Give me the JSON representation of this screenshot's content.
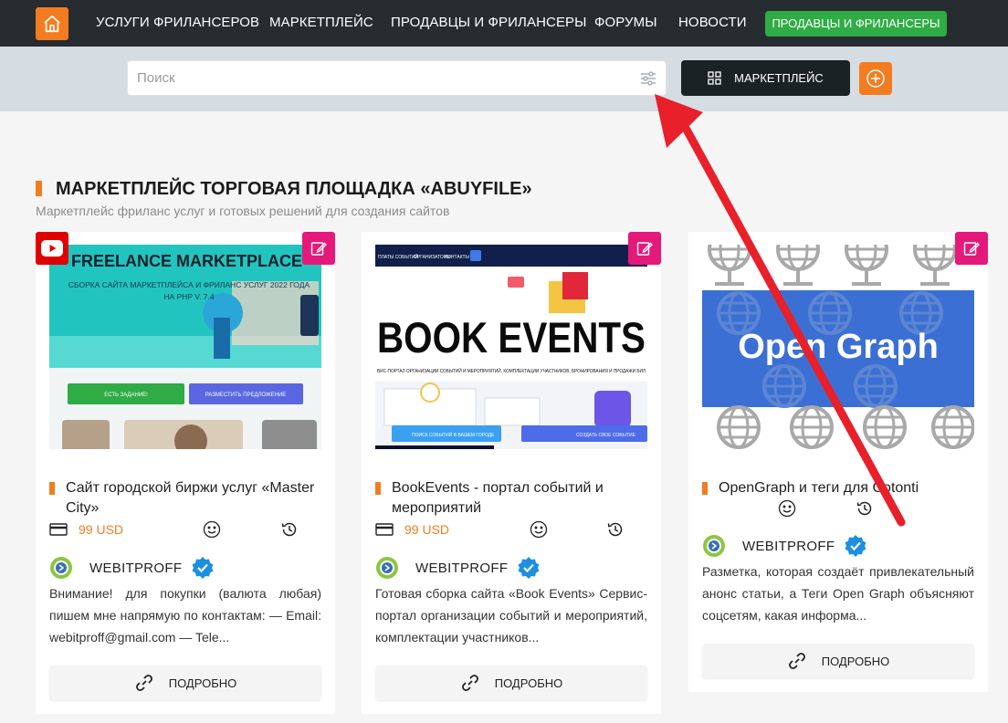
{
  "nav": {
    "items": [
      {
        "label": "УСЛУГИ ФРИЛАНСЕРОВ"
      },
      {
        "label": "МАРКЕТПЛЕЙС"
      },
      {
        "label": "ПРОДАВЦЫ И ФРИЛАНСЕРЫ"
      },
      {
        "label": "ФОРУМЫ"
      },
      {
        "label": "НОВОСТИ"
      }
    ],
    "green_button": "ПРОДАВЦЫ И ФРИЛАНСЕРЫ"
  },
  "search": {
    "placeholder": "Поиск",
    "marketplace_button": "МАРКЕТПЛЕЙС"
  },
  "section": {
    "title": "МАРКЕТПЛЕЙС ТОРГОВАЯ ПЛОЩАДКА «ABUYFILE»",
    "subtitle": "Маркетплейс фриланс услуг и готовых решений для создания сайтов"
  },
  "cards": [
    {
      "image": {
        "headline": "FREELANCE MARKETPLACE",
        "subline": "СБОРКА САЙТА МАРКЕТПЛЕЙСА И ФРИЛАНС УСЛУГ 2022 ГОДА НА PHP V. 7.4",
        "btn1": "ЕСТЬ ЗАДАНИЕ!",
        "btn2": "РАЗМЕСТИТЬ ПРЕДЛОЖЕНИЕ"
      },
      "title": "Сайт городской биржи услуг «Master City»",
      "price": "99 USD",
      "author": "WEBITPROFF",
      "description": "Внимание! для покупки (валюта любая) пишем мне напрямую по контактам: — Email: webitproff@gmail.com — Tele...",
      "more": "ПОДРОБНО"
    },
    {
      "image": {
        "headline": "BOOK EVENTS",
        "subline": "ВИС-ПОРТАЛ ОРГАНИЗАЦИИ СОБЫТИЙ И МЕРОПРИЯТИЙ, КОМПЛЕКТАЦИИ УЧАСТНИКОВ, БРОНИРОВАНИЯ И ПРОДАЖИ БИЛ",
        "top1": "ПЛАТЫ СОБЫТИЙ",
        "top2": "ОРГАНИЗАТОРЫ",
        "top3": "КОНТАКТЫ",
        "btn1": "ПОИСК СОБЫТИЙ В ВАШЕМ ГОРОДЕ",
        "btn2": "СОЗДАТЬ СВОЕ СОБЫТИЕ"
      },
      "title": "BookEvents - портал событий и мероприятий",
      "price": "99 USD",
      "author": "WEBITPROFF",
      "description": "Готовая сборка сайта «Book Events» Сервис-портал организации событий и мероприятий, комплектации участников...",
      "more": "ПОДРОБНО"
    },
    {
      "image": {
        "headline": "Open Graph"
      },
      "title": "OpenGraph и теги для Cotonti",
      "author": "WEBITPROFF",
      "description": "Разметка, которая создаёт привлекательный анонс статьи, а Теги Open Graph объясняют соцсетям, какая информа...",
      "more": "ПОДРОБНО"
    }
  ],
  "colors": {
    "accent": "#f47c20",
    "nav_bg": "#262c30",
    "green": "#2fac45",
    "pink": "#e5197a",
    "arrow": "#e8202a"
  }
}
